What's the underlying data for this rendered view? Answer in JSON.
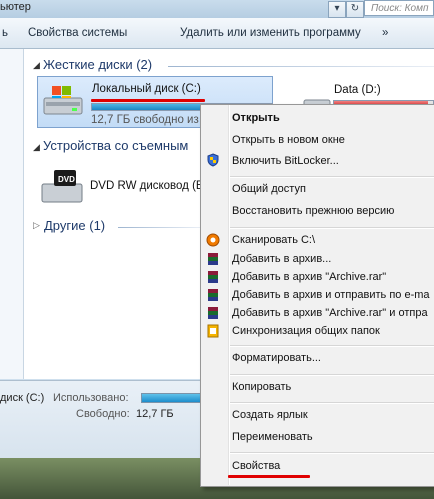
{
  "titlebar": {
    "address_tail": "ьютер",
    "search_placeholder": "Поиск: Комп"
  },
  "toolbar": {
    "items": [
      "ь",
      "Свойства системы",
      "Удалить или изменить программу",
      "»"
    ]
  },
  "groups": {
    "hard_disks": "Жесткие диски (2)",
    "removable": "Устройства со съемным",
    "other": "Другие (1)"
  },
  "drives": {
    "c_name": "Локальный диск (C:)",
    "c_free": "12,7 ГБ свободно из",
    "c_used_fraction": 0.8,
    "d_name": "Data (D:)",
    "d_used_fraction": 0.95,
    "dvd_name": "DVD RW дисковод (E",
    "dvd_icon_text": "DVD"
  },
  "details": {
    "drive": "диск (C:)",
    "used_label": "Использовано:",
    "free_label": "Свободно:",
    "free_value": "12,7 ГБ"
  },
  "context_menu": {
    "open": "Открыть",
    "open_new_window": "Открыть в новом окне",
    "bitlocker": "Включить BitLocker...",
    "sharing": "Общий доступ",
    "restore": "Восстановить прежнюю версию",
    "scan": "Сканировать C:\\",
    "add_archive": "Добавить в архив...",
    "add_archive_rar": "Добавить в архив \"Archive.rar\"",
    "add_email": "Добавить в архив и отправить по e-ma",
    "add_rar_email": "Добавить в архив \"Archive.rar\" и отпра",
    "sync": "Синхронизация общих папок",
    "format": "Форматировать...",
    "copy": "Копировать",
    "shortcut": "Создать ярлык",
    "rename": "Переименовать",
    "properties": "Свойства"
  },
  "colors": {
    "highlight_underline": "#e00000",
    "group_header": "#1e3a6a"
  }
}
